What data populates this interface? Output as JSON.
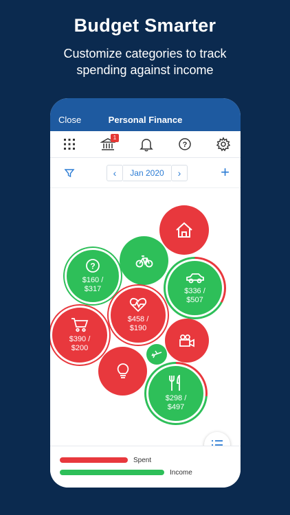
{
  "marketing": {
    "headline": "Budget Smarter",
    "subline": "Customize categories to track spending against income"
  },
  "titlebar": {
    "close_label": "Close",
    "title": "Personal Finance"
  },
  "iconbar": {
    "bank_badge": "1"
  },
  "datebar": {
    "prev": "‹",
    "month": "Jan 2020",
    "next": "›",
    "add": "+"
  },
  "categories": {
    "misc": {
      "spent": "$160 /",
      "budget": "$317"
    },
    "auto": {
      "spent": "$336 /",
      "budget": "$507"
    },
    "health": {
      "spent": "$458 /",
      "budget": "$190"
    },
    "shopping": {
      "spent": "$390 /",
      "budget": "$200"
    },
    "dining": {
      "spent": "$298 /",
      "budget": "$497"
    }
  },
  "legend": {
    "spent_label": "Spent",
    "income_label": "Income"
  },
  "colors": {
    "over_budget": "#e8383d",
    "under_budget": "#2ebf59",
    "brand_blue": "#1e5aa0",
    "background": "#0b2a4f"
  }
}
